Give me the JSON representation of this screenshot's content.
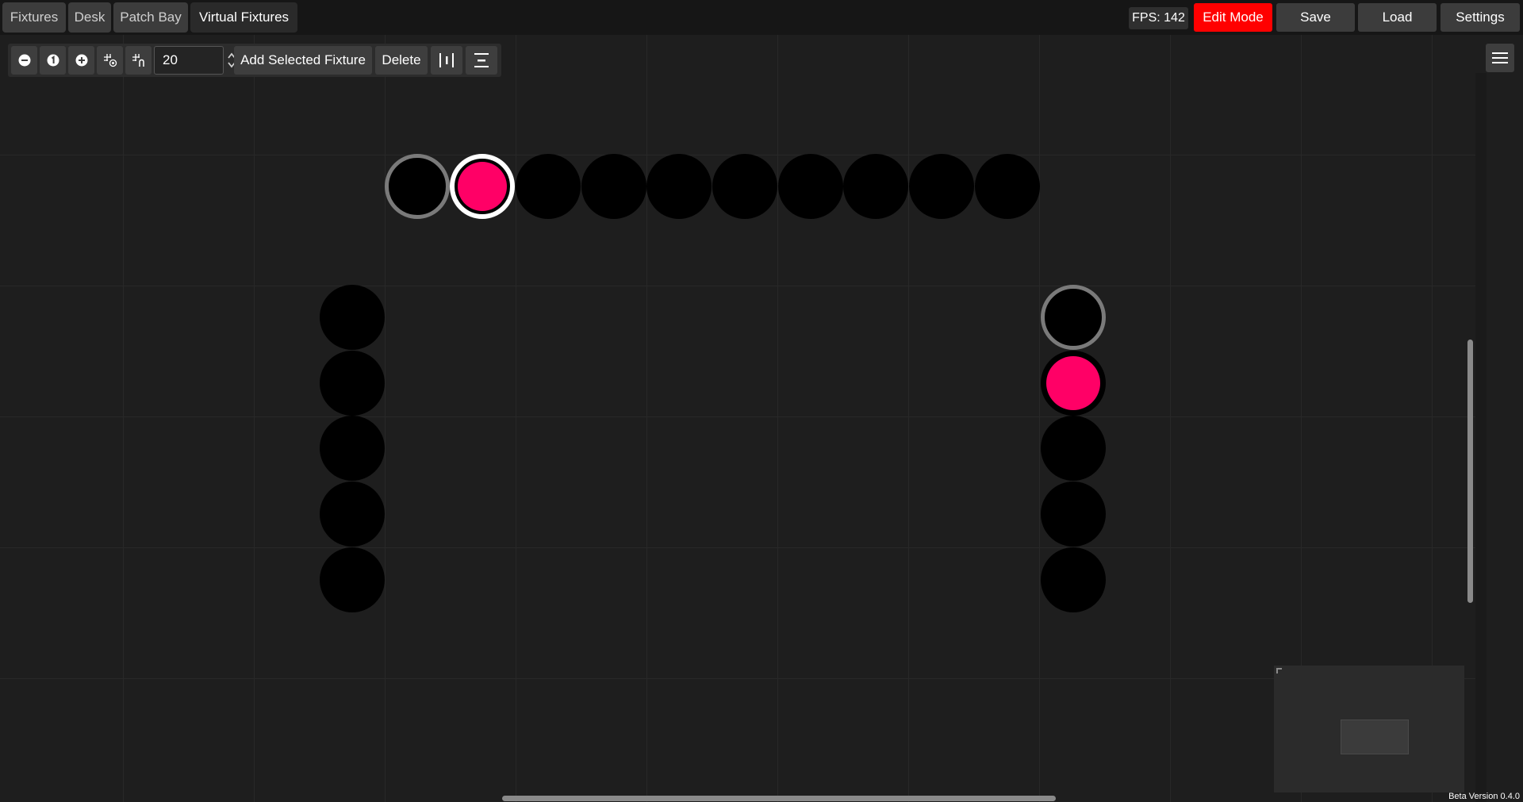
{
  "tabs": [
    {
      "label": "Fixtures",
      "active": false
    },
    {
      "label": "Desk",
      "active": false
    },
    {
      "label": "Patch Bay",
      "active": false
    },
    {
      "label": "Virtual Fixtures",
      "active": true
    }
  ],
  "header": {
    "fps_label": "FPS: 142",
    "edit_mode_label": "Edit Mode",
    "save_label": "Save",
    "load_label": "Load",
    "settings_label": "Settings"
  },
  "toolbar": {
    "zoom_out_icon": "minus-circle-icon",
    "zoom_reset_icon": "one-circle-icon",
    "zoom_in_icon": "plus-circle-icon",
    "grid_snap_icon": "grid-snap-icon",
    "grid_size_icon": "grid-size-icon",
    "grid_size_value": "20",
    "add_fixture_label": "Add Selected Fixture",
    "delete_label": "Delete",
    "distribute_horizontal_icon": "distribute-horizontal-icon",
    "distribute_vertical_icon": "distribute-vertical-icon"
  },
  "menu_icon": "hamburger-menu-icon",
  "colors": {
    "accent_red": "#ff0000",
    "fixture_pink": "#ff0066",
    "fixture_off": "#000000"
  },
  "fixtures": {
    "top_row": [
      {
        "state": "selected-gray",
        "color": "#000000"
      },
      {
        "state": "selected-white",
        "color": "#ff0066"
      },
      {
        "state": "normal",
        "color": "#000000"
      },
      {
        "state": "normal",
        "color": "#000000"
      },
      {
        "state": "normal",
        "color": "#000000"
      },
      {
        "state": "normal",
        "color": "#000000"
      },
      {
        "state": "normal",
        "color": "#000000"
      },
      {
        "state": "normal",
        "color": "#000000"
      },
      {
        "state": "normal",
        "color": "#000000"
      },
      {
        "state": "normal",
        "color": "#000000"
      }
    ],
    "left_column": [
      {
        "state": "normal",
        "color": "#000000"
      },
      {
        "state": "normal",
        "color": "#000000"
      },
      {
        "state": "normal",
        "color": "#000000"
      },
      {
        "state": "normal",
        "color": "#000000"
      },
      {
        "state": "normal",
        "color": "#000000"
      }
    ],
    "right_column": [
      {
        "state": "selected-gray",
        "color": "#000000"
      },
      {
        "state": "normal",
        "color": "#ff0066"
      },
      {
        "state": "normal",
        "color": "#000000"
      },
      {
        "state": "normal",
        "color": "#000000"
      },
      {
        "state": "normal",
        "color": "#000000"
      }
    ]
  },
  "version_label": "Beta Version 0.4.0"
}
